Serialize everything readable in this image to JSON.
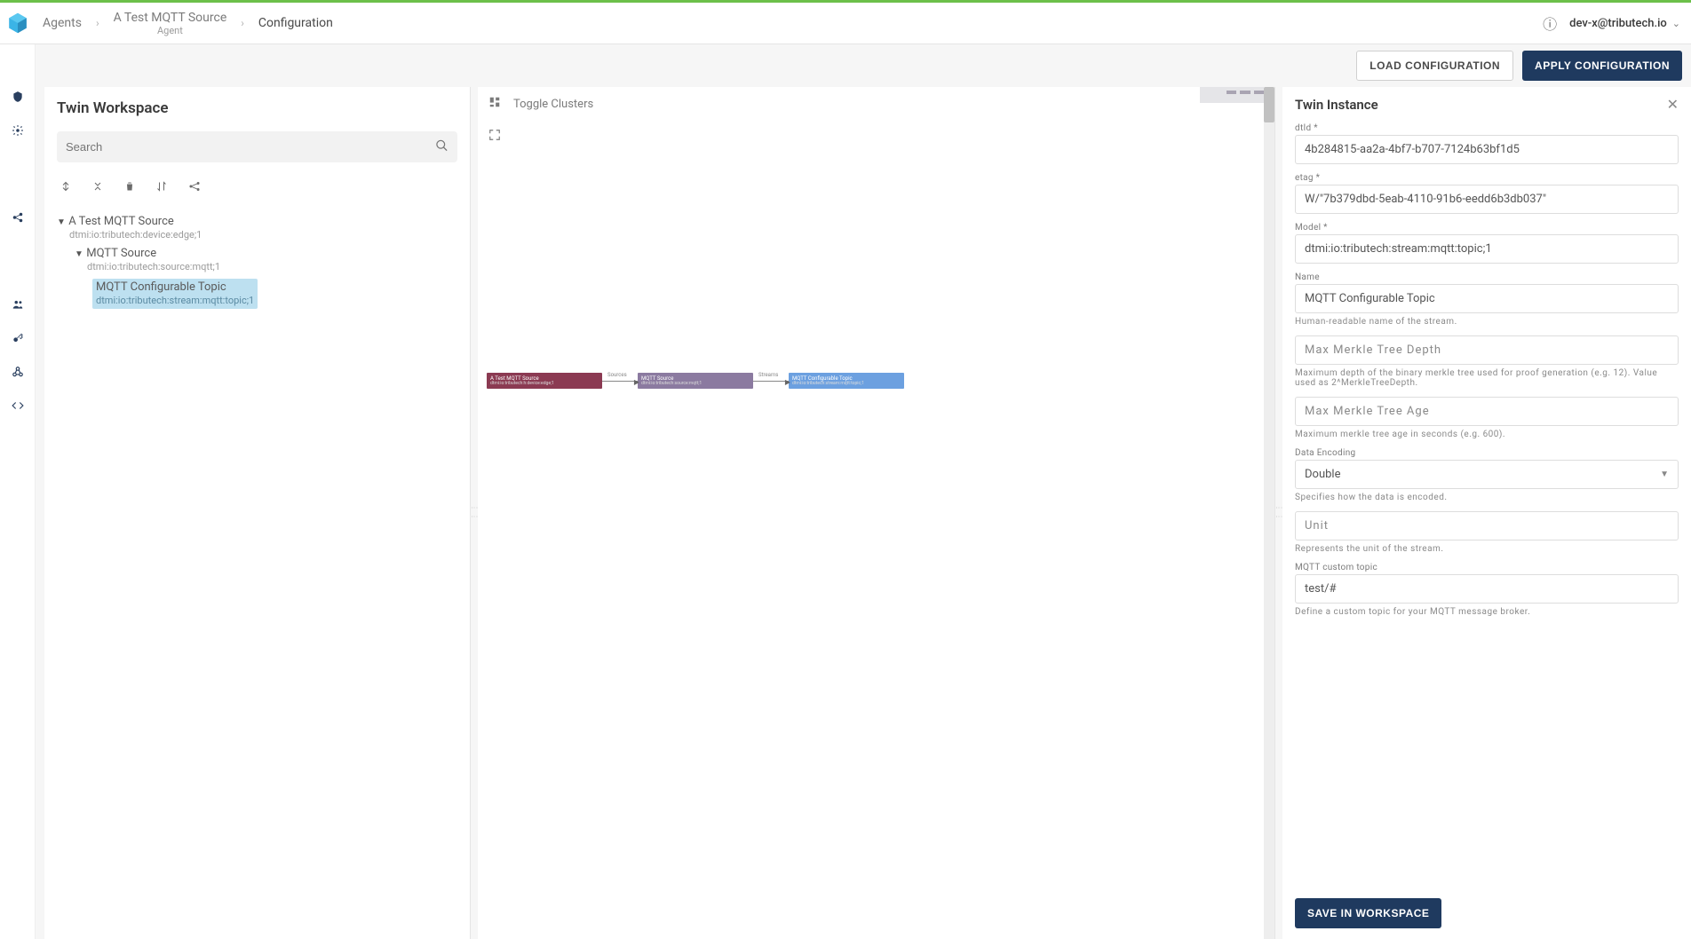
{
  "header": {
    "breadcrumb": {
      "agents": "Agents",
      "device": "A Test MQTT Source",
      "device_sub": "Agent",
      "current": "Configuration"
    },
    "user": "dev-x@tributech.io"
  },
  "actions": {
    "load": "LOAD CONFIGURATION",
    "apply": "APPLY CONFIGURATION"
  },
  "workspace": {
    "title": "Twin Workspace",
    "search_placeholder": "Search"
  },
  "tree": {
    "root": {
      "label": "A Test MQTT Source",
      "dtmi": "dtmi:io:tributech:device:edge;1"
    },
    "child1": {
      "label": "MQTT Source",
      "dtmi": "dtmi:io:tributech:source:mqtt;1"
    },
    "child2": {
      "label": "MQTT Configurable Topic",
      "dtmi": "dtmi:io:tributech:stream:mqtt:topic;1"
    }
  },
  "canvas": {
    "toggle_clusters": "Toggle Clusters",
    "graph": {
      "n1": {
        "title": "A Test MQTT Source",
        "sub": "dtmi:io:tributech:h:device:edge;1"
      },
      "e1": "Sources",
      "n2": {
        "title": "MQTT Source",
        "sub": "dtmi:io:tributech:source:mqtt;1"
      },
      "e2": "Streams",
      "n3": {
        "title": "MQTT Configurable Topic",
        "sub": "dtmi:io:tributech:stream:mqtt:topic;1"
      }
    }
  },
  "form": {
    "title": "Twin Instance",
    "fields": {
      "dtid": {
        "label": "dtId *",
        "value": "4b284815-aa2a-4bf7-b707-7124b63bf1d5"
      },
      "etag": {
        "label": "etag *",
        "value": "W/\"7b379dbd-5eab-4110-91b6-eedd6b3db037\""
      },
      "model": {
        "label": "Model *",
        "value": "dtmi:io:tributech:stream:mqtt:topic;1"
      },
      "name": {
        "label": "Name",
        "value": "MQTT Configurable Topic",
        "help": "Human-readable name of the stream."
      },
      "merkle_depth": {
        "placeholder": "Max Merkle Tree Depth",
        "help": "Maximum depth of the binary merkle tree used for proof generation (e.g. 12). Value used as 2^MerkleTreeDepth."
      },
      "merkle_age": {
        "placeholder": "Max Merkle Tree Age",
        "help": "Maximum merkle tree age in seconds (e.g. 600)."
      },
      "data_encoding": {
        "label": "Data Encoding",
        "value": "Double",
        "help": "Specifies how the data is encoded."
      },
      "unit": {
        "placeholder": "Unit",
        "help": "Represents the unit of the stream."
      },
      "mqtt_topic": {
        "label": "MQTT custom topic",
        "value": "test/#",
        "help": "Define a custom topic for your MQTT message broker."
      }
    },
    "save": "SAVE IN WORKSPACE"
  }
}
